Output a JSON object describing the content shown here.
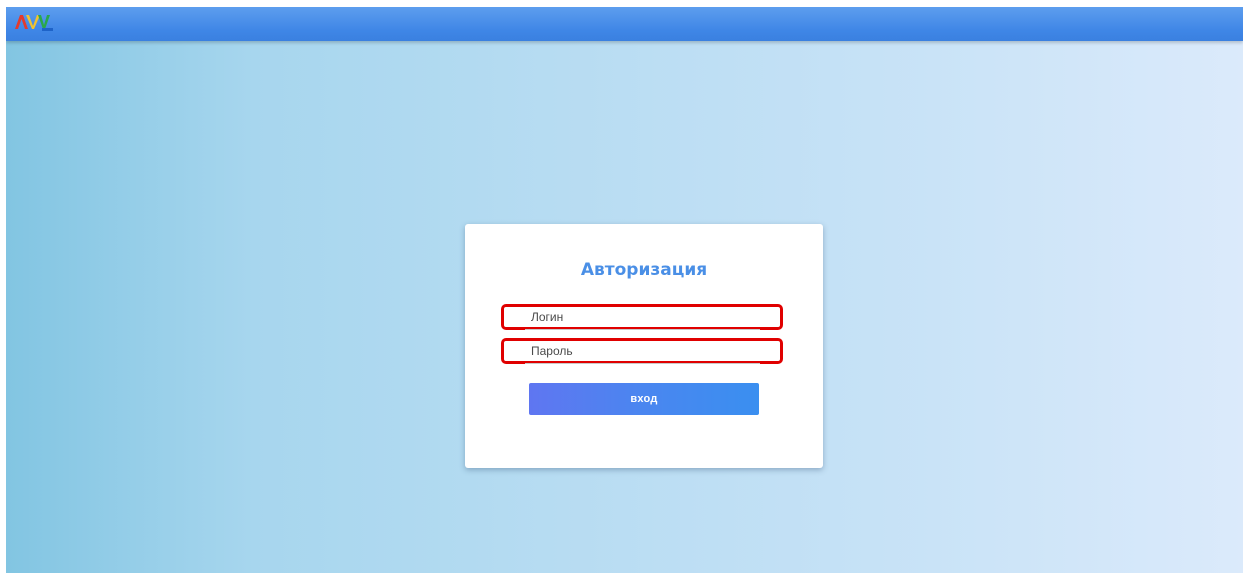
{
  "header": {
    "logo_text": "AVV",
    "logo_icon": "avv-logo-icon",
    "colors": {
      "bar": "#3f86e6"
    }
  },
  "login_form": {
    "title": "Авторизация",
    "login_placeholder": "Логин",
    "password_placeholder": "Пароль",
    "submit_label": "вход",
    "colors": {
      "title": "#4a8fe6",
      "highlight_border": "#e00000",
      "button_start": "#5f76f1",
      "button_end": "#3a8ff0"
    }
  }
}
